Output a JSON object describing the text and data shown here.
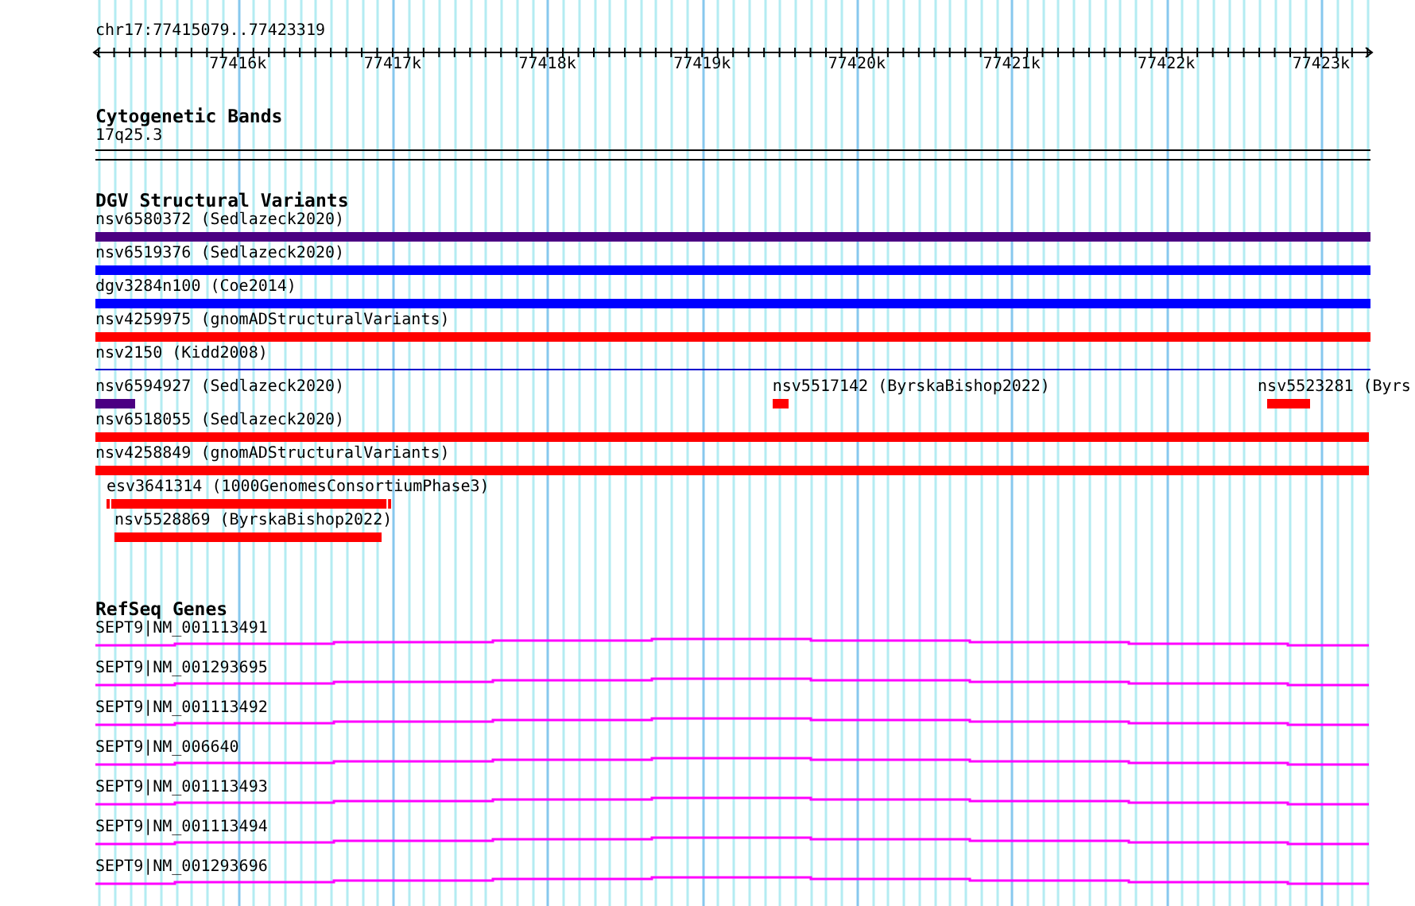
{
  "region": "chr17:77415079..77423319",
  "ruler": {
    "ticks": [
      "77416k",
      "77417k",
      "77418k",
      "77419k",
      "77420k",
      "77421k",
      "77422k",
      "77423k"
    ]
  },
  "tracks": [
    {
      "kind": "bands",
      "title": "Cytogenetic Bands",
      "bands": [
        {
          "label": "17q25.3"
        }
      ]
    },
    {
      "kind": "variants",
      "title": "DGV Structural Variants",
      "lanes": [
        {
          "features": [
            {
              "label": "nsv6580372 (Sedlazeck2020)",
              "color": "#4b0082",
              "kind": "bar"
            }
          ]
        },
        {
          "features": [
            {
              "label": "nsv6519376 (Sedlazeck2020)",
              "color": "#0000ff",
              "kind": "bar"
            }
          ]
        },
        {
          "features": [
            {
              "label": "dgv3284n100 (Coe2014)",
              "color": "#0000ff",
              "kind": "bar"
            }
          ]
        },
        {
          "features": [
            {
              "label": "nsv4259975 (gnomADStructuralVariants)",
              "color": "#ff0000",
              "kind": "bar"
            }
          ]
        },
        {
          "features": [
            {
              "label": "nsv2150 (Kidd2008)",
              "color": "#0000cd",
              "kind": "line"
            }
          ]
        },
        {
          "features": [
            {
              "label": "nsv6594927 (Sedlazeck2020)",
              "color": "#4b0082",
              "kind": "bar"
            },
            {
              "label": "nsv5517142 (ByrskaBishop2022)",
              "color": "#ff0000",
              "kind": "bar"
            },
            {
              "label": "nsv5523281 (Byrs",
              "color": "#ff0000",
              "kind": "bar"
            }
          ]
        },
        {
          "features": [
            {
              "label": "nsv6518055 (Sedlazeck2020)",
              "color": "#ff0000",
              "kind": "bar"
            }
          ]
        },
        {
          "features": [
            {
              "label": "nsv4258849 (gnomADStructuralVariants)",
              "color": "#ff0000",
              "kind": "bar"
            }
          ]
        },
        {
          "features": [
            {
              "label": "esv3641314 (1000GenomesConsortiumPhase3)",
              "color": "#ff0000",
              "kind": "capped"
            }
          ]
        },
        {
          "features": [
            {
              "label": "nsv5528869 (ByrskaBishop2022)",
              "color": "#ff0000",
              "kind": "bar"
            }
          ]
        }
      ]
    },
    {
      "kind": "genes",
      "title": "RefSeq Genes",
      "genes": [
        {
          "label": "SEPT9|NM_001113491"
        },
        {
          "label": "SEPT9|NM_001293695"
        },
        {
          "label": "SEPT9|NM_001113492"
        },
        {
          "label": "SEPT9|NM_006640"
        },
        {
          "label": "SEPT9|NM_001113493"
        },
        {
          "label": "SEPT9|NM_001113494"
        },
        {
          "label": "SEPT9|NM_001293696"
        }
      ]
    }
  ]
}
